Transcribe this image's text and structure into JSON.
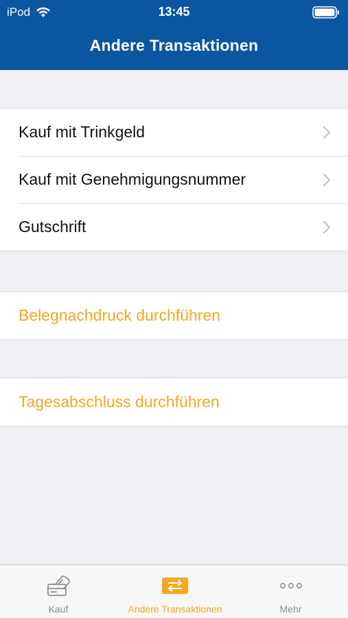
{
  "status_bar": {
    "carrier": "iPod",
    "time": "13:45"
  },
  "nav": {
    "title": "Andere Transaktionen"
  },
  "menu": {
    "items": [
      {
        "label": "Kauf mit Trinkgeld",
        "icon": "chevron-right-icon"
      },
      {
        "label": "Kauf mit Genehmigungsnummer",
        "icon": "chevron-right-icon"
      },
      {
        "label": "Gutschrift",
        "icon": "chevron-right-icon"
      }
    ]
  },
  "actions": {
    "reprint": "Belegnachdruck durchführen",
    "day_close": "Tagesabschluss durchführen"
  },
  "tab_bar": {
    "tabs": [
      {
        "label": "Kauf",
        "icon": "card-payment-icon",
        "active": false
      },
      {
        "label": "Andere Transaktionen",
        "icon": "transfer-arrows-icon",
        "active": true
      },
      {
        "label": "Mehr",
        "icon": "more-dots-icon",
        "active": false
      }
    ]
  },
  "colors": {
    "header_bg": "#0a56a0",
    "accent": "#f5a623",
    "background": "#efeff4",
    "inactive": "#8e8e93"
  }
}
